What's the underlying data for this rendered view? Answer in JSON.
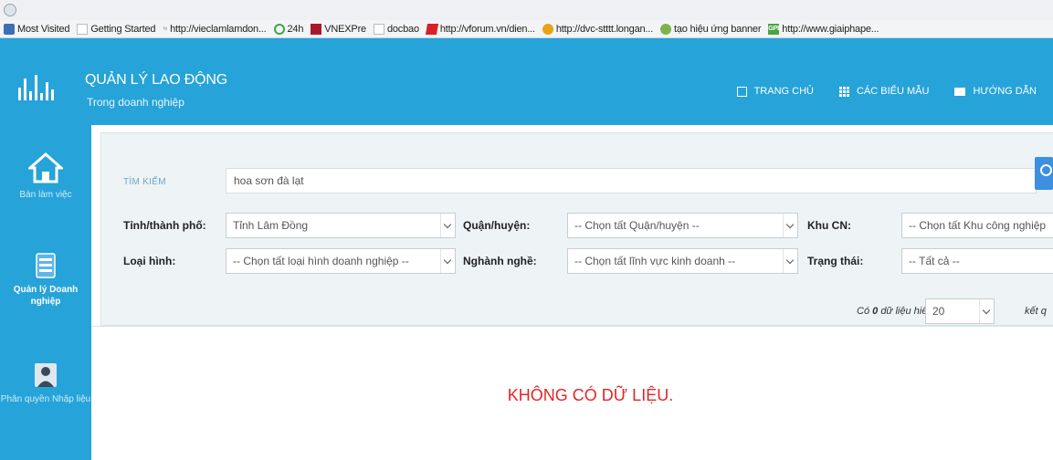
{
  "bookmarks": [
    {
      "label": "Most Visited",
      "icon": "bookmark-star-icon"
    },
    {
      "label": "Getting Started",
      "icon": "page-icon"
    },
    {
      "label": "http://vieclamlamdon...",
      "icon": "site-icon"
    },
    {
      "label": "24h",
      "icon": "clock-icon"
    },
    {
      "label": "VNEXPre",
      "icon": "vnexpress-icon"
    },
    {
      "label": "docbao",
      "icon": "page-icon"
    },
    {
      "label": "http://vforum.vn/dien...",
      "icon": "vforum-icon"
    },
    {
      "label": "http://dvc-stttt.longan...",
      "icon": "dvc-icon"
    },
    {
      "label": "tạo hiệu ứng banner",
      "icon": "globe-icon"
    },
    {
      "label": "http://www.giaiphape...",
      "icon": "gpe-icon"
    }
  ],
  "header": {
    "title": "QUẢN LÝ LAO ĐỘNG",
    "subtitle": "Trong doanh nghiệp",
    "nav": [
      {
        "label": "TRANG CHỦ",
        "icon": "home-icon"
      },
      {
        "label": "CÁC BIỂU MẪU",
        "icon": "grid-icon"
      },
      {
        "label": "HƯỚNG DẪN",
        "icon": "book-icon"
      }
    ],
    "background_color": "#26a3d8"
  },
  "sidebar": {
    "items": [
      {
        "label": "Bàn làm việc",
        "icon": "home-icon"
      },
      {
        "label": "Quản lý Doanh nghiệp",
        "icon": "database-icon"
      },
      {
        "label": "Phân quyền Nhập liệu",
        "icon": "user-icon"
      }
    ]
  },
  "search": {
    "label": "TÌM KIẾM",
    "value": "hoa sơn đà lạt"
  },
  "filters": {
    "province_label": "Tỉnh/thành phố:",
    "province_value": "Tỉnh Lâm Đồng",
    "district_label": "Quận/huyện:",
    "district_value": "-- Chọn tất Quận/huyện --",
    "zone_label": "Khu CN:",
    "zone_value": "-- Chọn tất Khu công nghiệp",
    "type_label": "Loại hình:",
    "type_value": "-- Chọn tất loại hình doanh nghiệp --",
    "industry_label": "Nghành nghề:",
    "industry_value": "-- Chọn tất lĩnh vực kinh doanh --",
    "status_label": "Trạng thái:",
    "status_value": "-- Tất cả --"
  },
  "results": {
    "count_prefix": "Có",
    "count": "0",
    "count_suffix": "dữ liệu hiển thị",
    "page_size": "20",
    "page_size_suffix": "kết q",
    "empty_message": "KHÔNG CÓ DỮ LIỆU."
  }
}
